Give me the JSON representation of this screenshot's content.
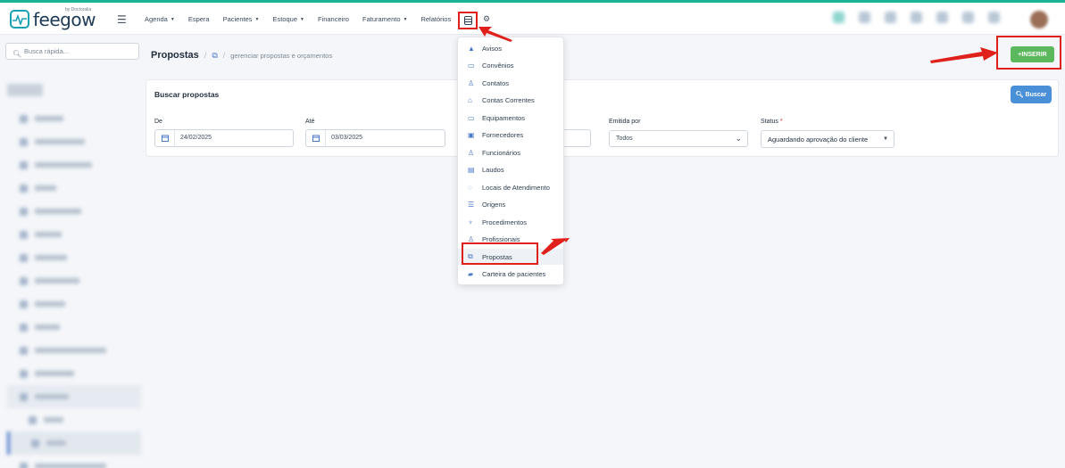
{
  "brand": {
    "name": "feegow",
    "by": "by Doctoralia"
  },
  "nav": {
    "items": [
      {
        "label": "Agenda",
        "caret": true
      },
      {
        "label": "Espera",
        "caret": false
      },
      {
        "label": "Pacientes",
        "caret": true
      },
      {
        "label": "Estoque",
        "caret": true
      },
      {
        "label": "Financeiro",
        "caret": false
      },
      {
        "label": "Faturamento",
        "caret": true
      },
      {
        "label": "Relatórios",
        "caret": false
      }
    ]
  },
  "sidebar": {
    "search_placeholder": "Busca rápida..."
  },
  "breadcrumb": {
    "title": "Propostas",
    "sub": "gerenciar propostas e orçamentos"
  },
  "actions": {
    "insert_label": "INSERIR",
    "search_label": "Buscar"
  },
  "filters": {
    "title": "Buscar propostas",
    "de_label": "De",
    "de_value": "24/02/2025",
    "ate_label": "Até",
    "ate_value": "03/03/2025",
    "emitida_label": "Emitida por",
    "emitida_value": "Todos",
    "status_label": "Status",
    "status_required": "*",
    "status_value": "Aguardando aprovação do cliente"
  },
  "dropdown": {
    "items": [
      {
        "label": "Avisos",
        "icon": "warning-icon"
      },
      {
        "label": "Convênios",
        "icon": "card-icon"
      },
      {
        "label": "Contatos",
        "icon": "user-icon"
      },
      {
        "label": "Contas Correntes",
        "icon": "bank-icon"
      },
      {
        "label": "Equipamentos",
        "icon": "laptop-icon"
      },
      {
        "label": "Fornecedores",
        "icon": "box-icon"
      },
      {
        "label": "Funcionários",
        "icon": "user-icon"
      },
      {
        "label": "Laudos",
        "icon": "file-icon"
      },
      {
        "label": "Locais de Atendimento",
        "icon": "location-icon"
      },
      {
        "label": "Origens",
        "icon": "list-icon"
      },
      {
        "label": "Procedimentos",
        "icon": "stethoscope-icon"
      },
      {
        "label": "Profissionais",
        "icon": "user-icon"
      },
      {
        "label": "Propostas",
        "icon": "copy-icon"
      },
      {
        "label": "Carteira de pacientes",
        "icon": "book-icon"
      }
    ],
    "highlighted": "Propostas"
  },
  "colors": {
    "accent": "#4a90d9",
    "success": "#5cb85c",
    "annotation": "#e0201a",
    "brand_teal": "#1aa0b4"
  }
}
